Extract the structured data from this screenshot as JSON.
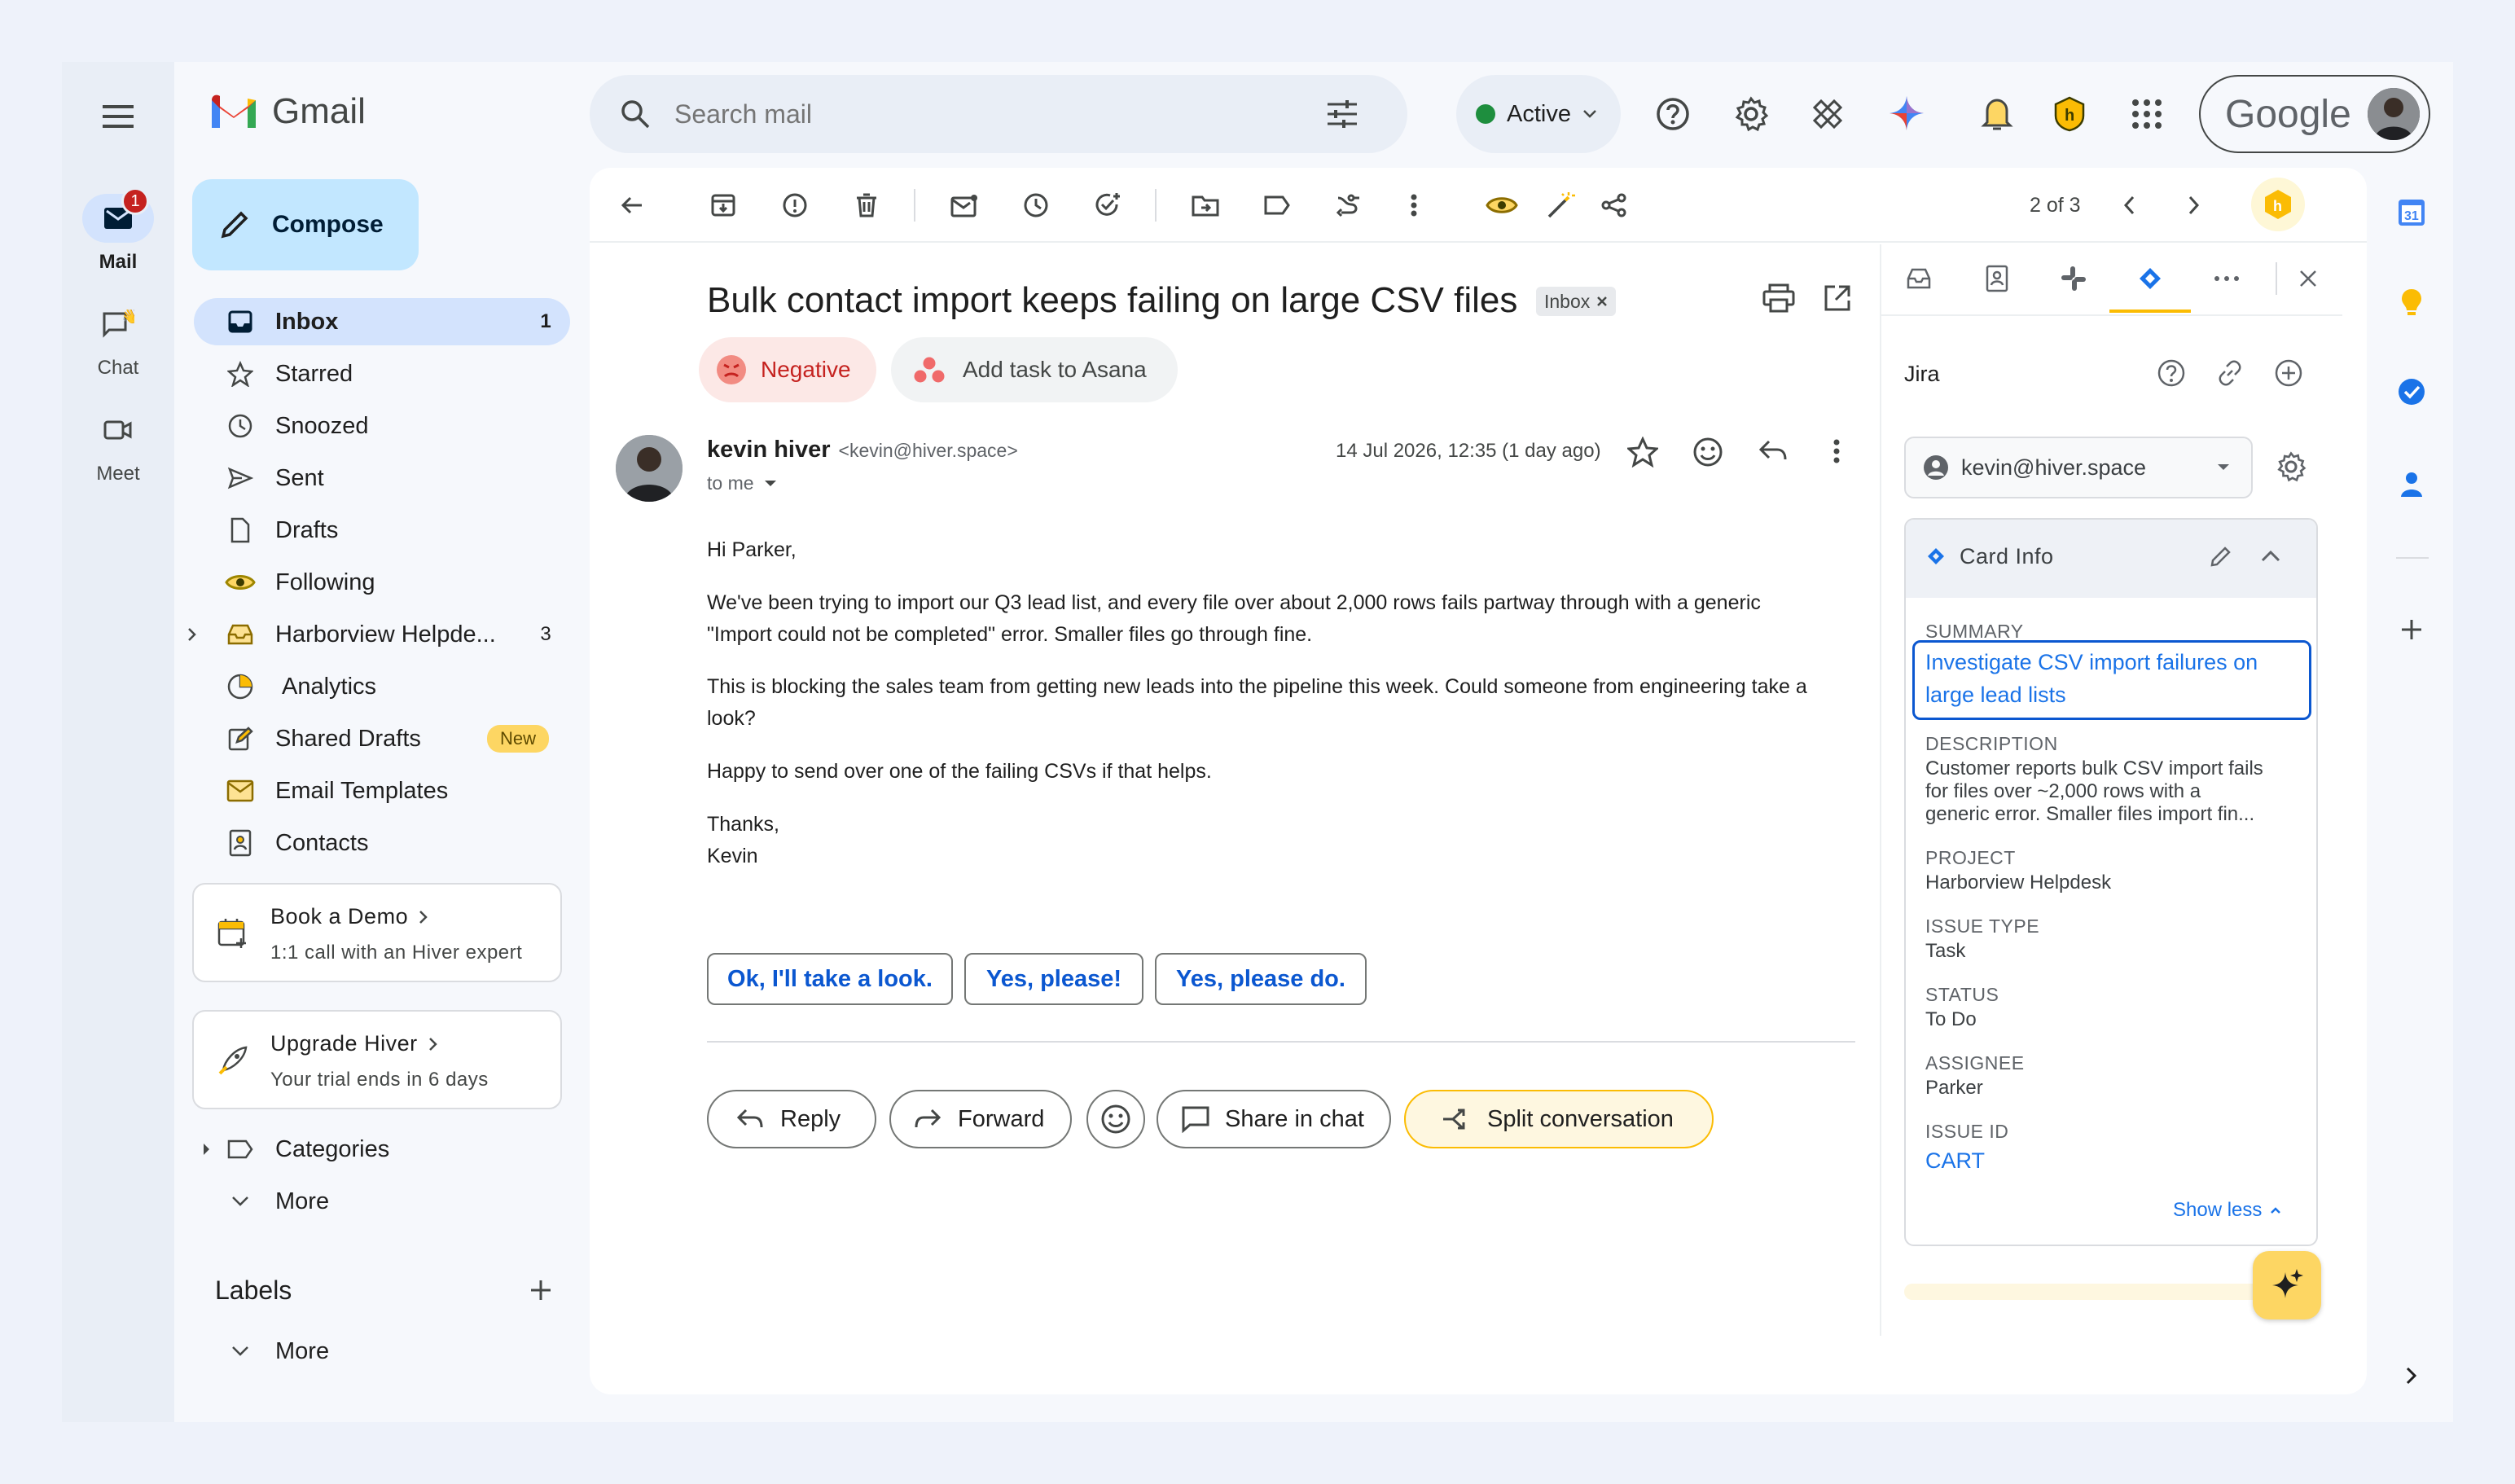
{
  "app": {
    "name": "Gmail"
  },
  "rail": {
    "items": [
      {
        "label": "Mail",
        "badge": "1"
      },
      {
        "label": "Chat"
      },
      {
        "label": "Meet"
      }
    ]
  },
  "compose": {
    "label": "Compose"
  },
  "nav": {
    "items": [
      {
        "label": "Inbox",
        "count": "1"
      },
      {
        "label": "Starred"
      },
      {
        "label": "Snoozed"
      },
      {
        "label": "Sent"
      },
      {
        "label": "Drafts"
      },
      {
        "label": "Following"
      },
      {
        "label": "Harborview Helpde...",
        "count": "3"
      },
      {
        "label": "Analytics"
      },
      {
        "label": "Shared Drafts",
        "badge": "New"
      },
      {
        "label": "Email Templates"
      },
      {
        "label": "Contacts"
      }
    ],
    "book_demo": {
      "title": "Book a Demo",
      "subtitle": "1:1 call with an Hiver expert"
    },
    "upgrade": {
      "title": "Upgrade Hiver",
      "subtitle": "Your trial ends in 6 days"
    },
    "categories": "Categories",
    "more": "More",
    "labels_title": "Labels",
    "labels_more": "More"
  },
  "search": {
    "placeholder": "Search mail"
  },
  "header": {
    "status": "Active",
    "account_brand": "Google"
  },
  "toolbar": {
    "pagination": "2 of 3"
  },
  "email": {
    "subject": "Bulk contact import keeps failing on large CSV files",
    "label_chip": "Inbox",
    "sentiment": "Negative",
    "asana": "Add task to Asana",
    "sender_name": "kevin hiver",
    "sender_email": "<kevin@hiver.space>",
    "to": "to me",
    "date": "14 Jul 2026, 12:35 (1 day ago)",
    "body": [
      "Hi Parker,",
      "We've been trying to import our Q3 lead list, and every file over about 2,000 rows fails partway through with a generic",
      "\"Import could not be completed\" error. Smaller files go through fine.",
      "This is blocking the sales team from getting new leads into the pipeline this week. Could someone from engineering take a",
      "look?",
      "Happy to send over one of the failing CSVs if that helps.",
      "Thanks,",
      "Kevin"
    ],
    "smart_replies": [
      "Ok, I'll take a look.",
      "Yes, please!",
      "Yes, please do."
    ],
    "actions": {
      "reply": "Reply",
      "forward": "Forward",
      "share": "Share in chat",
      "split": "Split conversation"
    }
  },
  "jira": {
    "title": "Jira",
    "account": "kevin@hiver.space",
    "card_title": "Card Info",
    "fields": {
      "summary_label": "SUMMARY",
      "summary_line1": "Investigate CSV import failures on",
      "summary_line2": "large lead lists",
      "description_label": "DESCRIPTION",
      "description_line1": "Customer reports bulk CSV import fails",
      "description_line2": "for files over ~2,000 rows with a",
      "description_line3": "generic error. Smaller files import fin...",
      "project_label": "PROJECT",
      "project": "Harborview Helpdesk",
      "issue_type_label": "ISSUE TYPE",
      "issue_type": "Task",
      "status_label": "STATUS",
      "status": "To Do",
      "assignee_label": "ASSIGNEE",
      "assignee": "Parker",
      "issue_id_label": "ISSUE ID",
      "issue_id": "CART"
    },
    "show_less": "Show less"
  },
  "right_rail": {
    "calendar_day": "31"
  },
  "colors": {
    "accent_blue": "#0b57d0",
    "nav_active": "#d3e3fd",
    "negative_bg": "#fce8e6",
    "active_green": "#1e8e3e",
    "jira_blue": "#1a73e8"
  }
}
